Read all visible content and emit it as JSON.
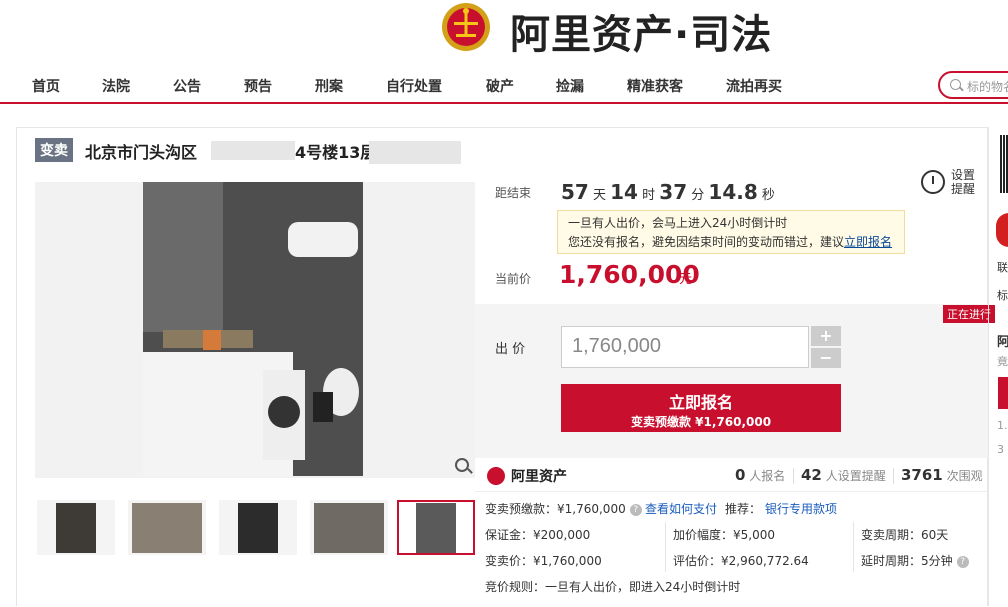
{
  "header": {
    "brand": "阿里资产·司法",
    "nav": [
      "首页",
      "法院",
      "公告",
      "预告",
      "刑案",
      "自行处置",
      "破产",
      "捡漏",
      "精准获客",
      "流拍再买"
    ],
    "search_placeholder": "标的物名称"
  },
  "item": {
    "tag": "变卖",
    "title_prefix": "北京市门头沟区",
    "title_middle": "4号楼13层"
  },
  "countdown": {
    "label": "距结束",
    "days": "57",
    "days_unit": "天",
    "hours": "14",
    "hours_unit": "时",
    "minutes": "37",
    "minutes_unit": "分",
    "seconds": "14.8",
    "seconds_unit": "秒"
  },
  "reminder": {
    "line1": "设置",
    "line2": "提醒"
  },
  "notice": {
    "line1": "一旦有人出价，会马上进入24小时倒计时",
    "line2_text": "您还没有报名，避免因结束时间的变动而错过，建议",
    "line2_link": "立即报名"
  },
  "price": {
    "label": "当前价",
    "value": "1,760,000",
    "unit": "元"
  },
  "bid": {
    "status": "正在进行",
    "label": "出  价",
    "value": "1,760,000",
    "plus": "+",
    "minus": "−",
    "signup_main": "立即报名",
    "signup_sub": "变卖预缴款 ¥1,760,000"
  },
  "stats": {
    "platform": "阿里资产",
    "signups": "0",
    "signups_label": "人报名",
    "reminders": "42",
    "reminders_label": "人设置提醒",
    "views": "3761",
    "views_label": "次围观"
  },
  "details": {
    "deposit": "变卖预缴款：¥1,760,000",
    "pay_link": "查看如何支付",
    "recommend": "推荐：",
    "recommend_link": "银行专用款项",
    "margin": "保证金：¥200,000",
    "increment": "加价幅度：¥5,000",
    "period": "变卖周期：60天",
    "sale_price": "变卖价：¥1,760,000",
    "assessed": "评估价：¥2,960,772.64",
    "delay": "延时周期：5分钟",
    "rule": "竞价规则：一旦有人出价，即进入24小时倒计时"
  },
  "edge": {
    "t1": "联",
    "t2": "标",
    "t3": "阿",
    "t4": "竟",
    "t5": "1.",
    "t6": "3"
  }
}
